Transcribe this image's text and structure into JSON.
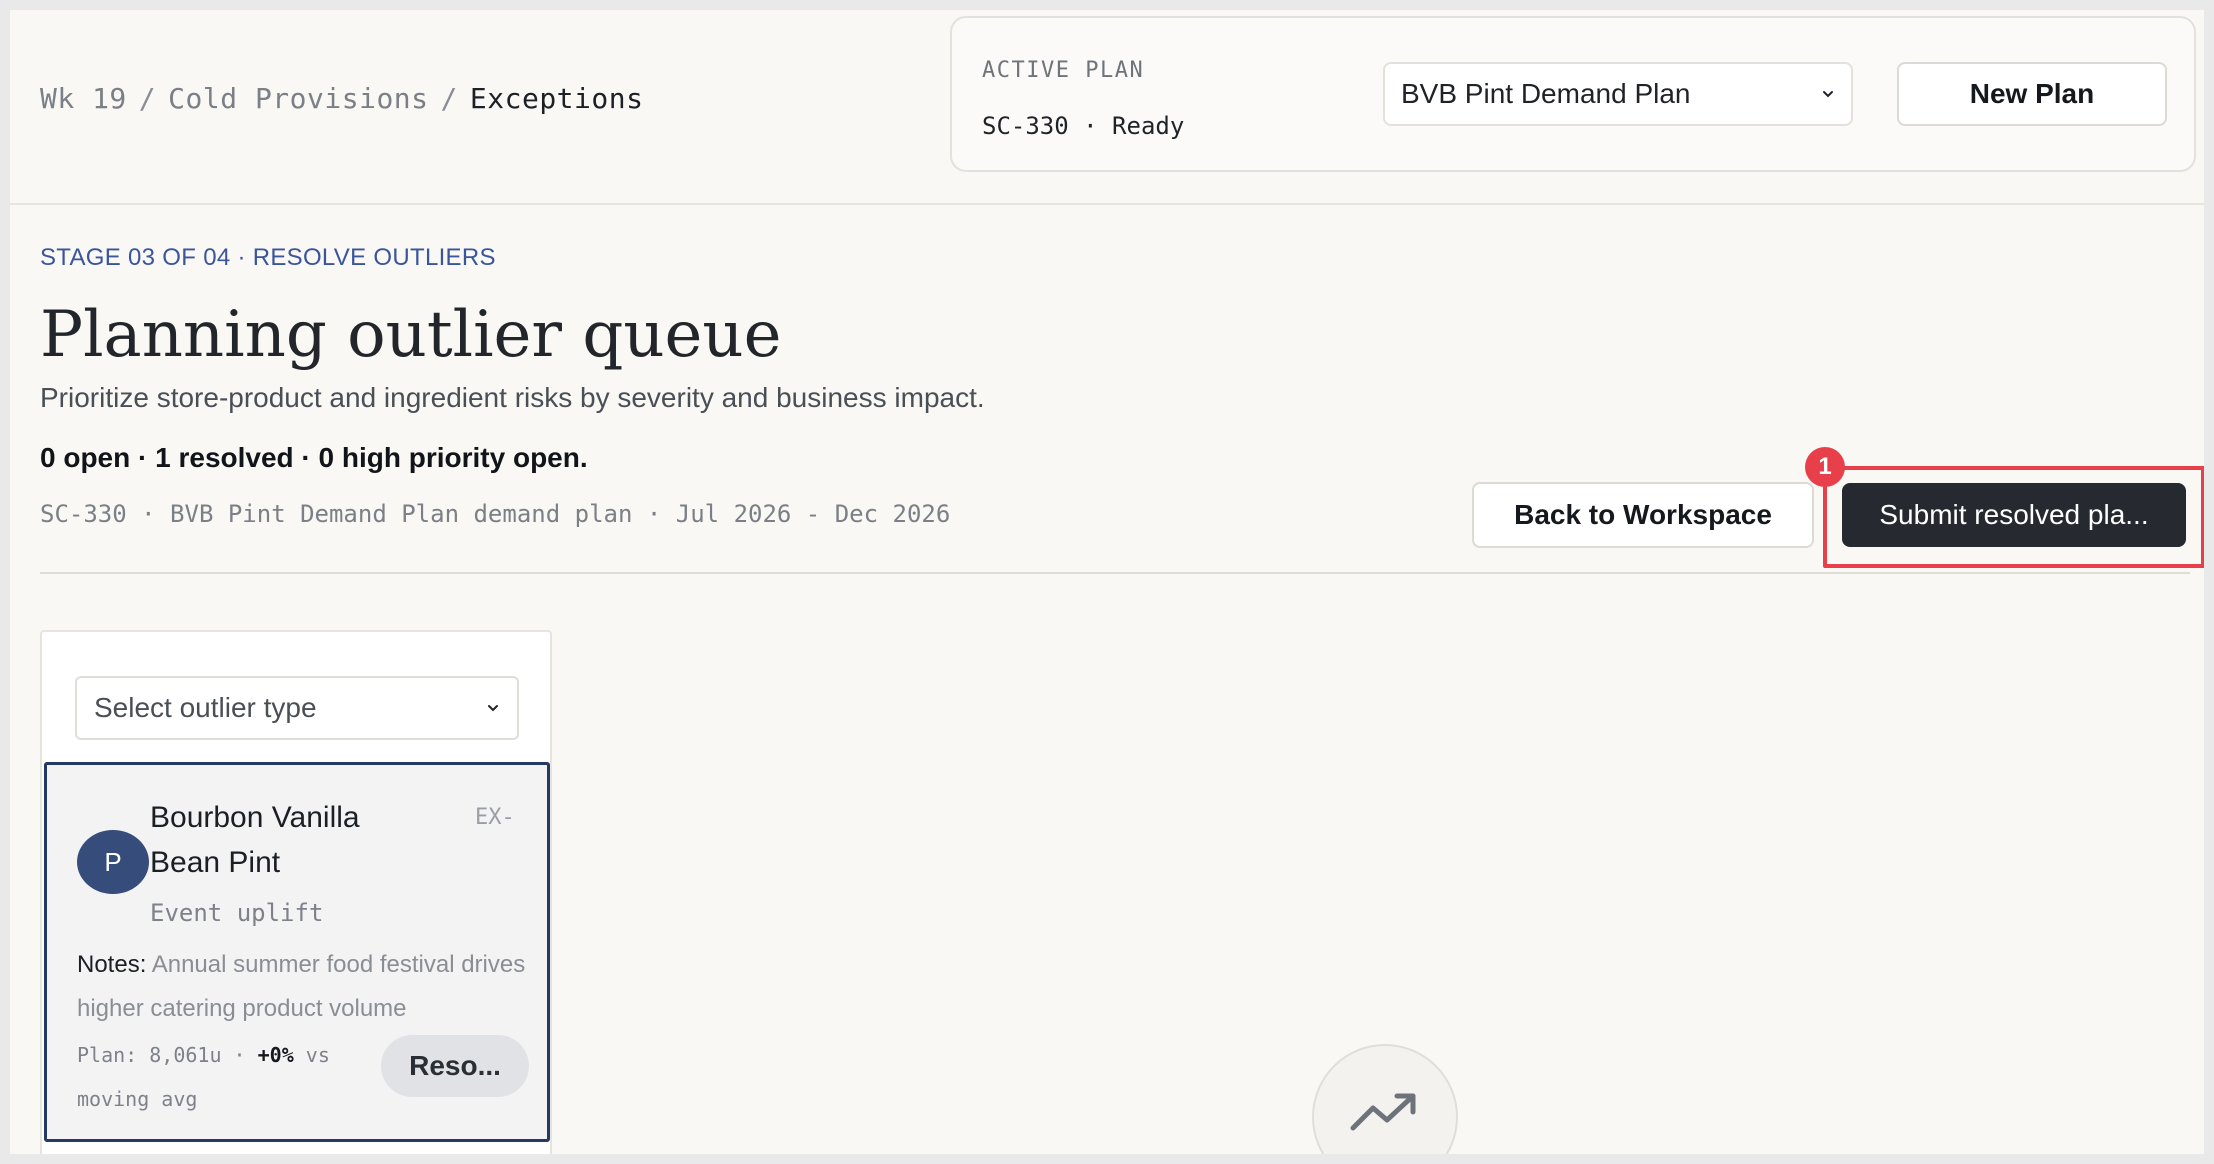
{
  "breadcrumb": {
    "week": "Wk 19",
    "category": "Cold Provisions",
    "current": "Exceptions",
    "separator": "/"
  },
  "active_plan": {
    "label": "ACTIVE PLAN",
    "status": "SC-330 · Ready",
    "selected_plan": "BVB Pint Demand Plan",
    "new_plan_label": "New Plan"
  },
  "header": {
    "stage": "STAGE 03 OF 04 · RESOLVE OUTLIERS",
    "title": "Planning outlier queue",
    "subtitle": "Prioritize store-product and ingredient risks by severity and business impact.",
    "counts": "0 open · 1 resolved · 0 high priority open.",
    "meta": "SC-330 · BVB Pint Demand Plan demand plan · Jul 2026 - Dec 2026",
    "back_label": "Back to Workspace",
    "submit_label": "Submit resolved pla...",
    "annotation_number": "1"
  },
  "filter": {
    "outlier_type_placeholder": "Select outlier type"
  },
  "outliers": [
    {
      "avatar": "P",
      "product": "Bourbon Vanilla Bean Pint",
      "id": "EX-",
      "type": "Event uplift",
      "notes_label": "Notes:",
      "notes": "Annual summer food festival drives higher catering product volume",
      "plan_prefix": "Plan: 8,061u ·",
      "plan_change": "+0%",
      "plan_suffix": "vs moving avg",
      "resolve_label": "Reso..."
    }
  ],
  "colors": {
    "accent": "#3a559b",
    "primary_button": "#262a30",
    "card_border": "#253a63",
    "avatar": "#364d7c",
    "annotation": "#e8404b",
    "background": "#f9f8f5"
  },
  "icons": {
    "plan_select": "chevron-down-icon",
    "type_select": "chevron-down-icon",
    "empty_state": "trending-up-icon"
  }
}
